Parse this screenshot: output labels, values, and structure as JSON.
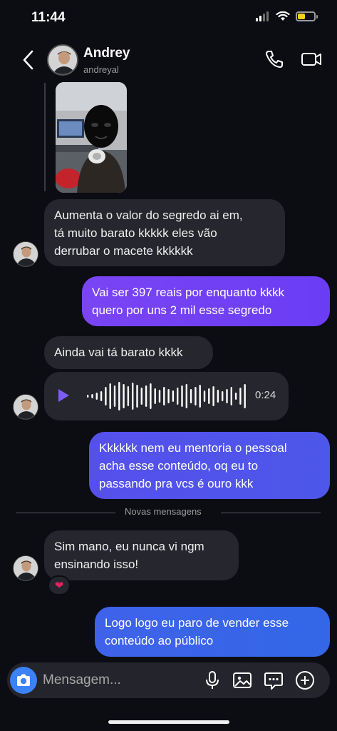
{
  "status": {
    "time": "11:44"
  },
  "header": {
    "name": "Andrey",
    "username": "andreyal"
  },
  "messages": [
    {
      "text": "Aumenta o valor do segredo ai em,\ntá muito barato kkkkk eles vão\nderrubar o macete kkkkkk"
    },
    {
      "text": "Vai ser 397 reais por enquanto kkkk\nquero por uns 2 mil esse segredo"
    },
    {
      "text": "Ainda vai tá barato kkkk"
    },
    {
      "duration": "0:24"
    },
    {
      "text": "Kkkkkk nem eu mentoria o pessoal\nacha esse conteúdo, oq eu to\npassando pra vcs é ouro kkk"
    },
    {
      "text": "Sim mano, eu nunca vi ngm\nensinando isso!",
      "reaction": "❤"
    },
    {
      "text": "Logo logo eu paro de vender esse\nconteúdo ao público"
    }
  ],
  "divider": {
    "label": "Novas mensagens"
  },
  "composer": {
    "placeholder": "Mensagem..."
  },
  "colors": {
    "outgoing_purple": "#6a3df5",
    "outgoing_blue": "#3367e8",
    "accent": "#3b82f6",
    "background": "#0c0c13",
    "incoming": "#26262e"
  },
  "icons": [
    "back-chevron",
    "phone",
    "video-camera",
    "play",
    "camera",
    "microphone",
    "image",
    "sticker",
    "plus"
  ]
}
